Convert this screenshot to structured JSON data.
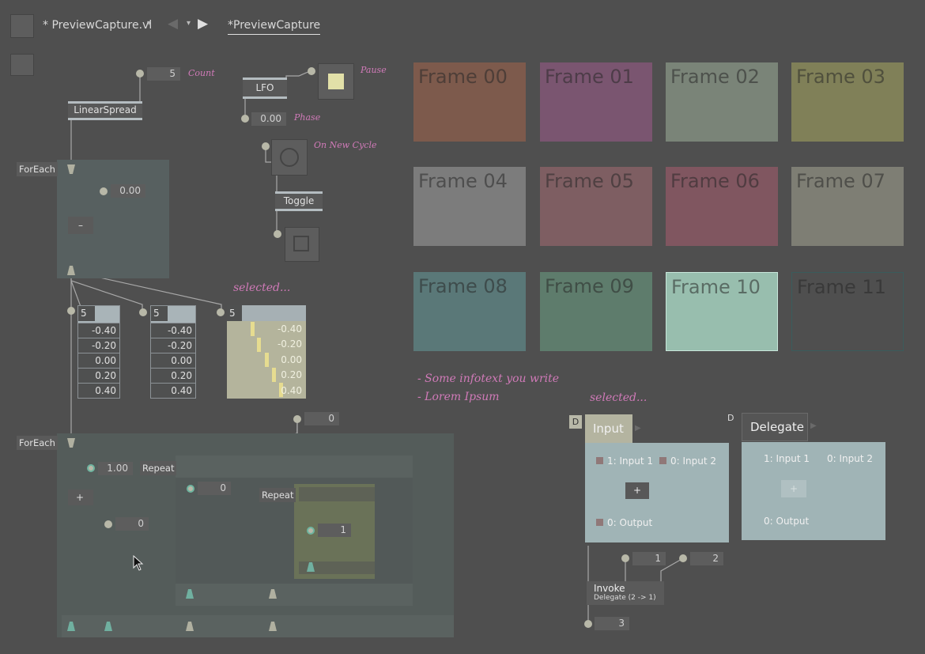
{
  "header": {
    "doc_title": "* PreviewCapture.vl",
    "tab_label": "*PreviewCapture"
  },
  "patch": {
    "count_label": "Count",
    "count_value": "5",
    "linearspread": "LinearSpread",
    "lfo": "LFO",
    "pause_label": "Pause",
    "phase_value": "0.00",
    "phase_label": "Phase",
    "newcycle_label": "On New Cycle",
    "toggle": "Toggle",
    "foreach1": "ForEach",
    "foreach1_input": "0.00",
    "minus": "–",
    "selected1": "selected...",
    "tables": [
      {
        "count": "5",
        "values": [
          "-0.40",
          "-0.20",
          "0.00",
          "0.20",
          "0.40"
        ]
      },
      {
        "count": "5",
        "values": [
          "-0.40",
          "-0.20",
          "0.00",
          "0.20",
          "0.40"
        ]
      },
      {
        "count": "5",
        "values": [
          "-0.40",
          "-0.20",
          "0.00",
          "0.20",
          "0.40"
        ]
      }
    ],
    "zero_top": "0",
    "foreach2": "ForEach",
    "one_input": "1.00",
    "plus": "+",
    "repeat1": "Repeat",
    "repeat2": "Repeat",
    "inner_zero": "0",
    "inner_one": "1",
    "left_zero": "0"
  },
  "frames": [
    "Frame 00",
    "Frame 01",
    "Frame 02",
    "Frame 03",
    "Frame 04",
    "Frame 05",
    "Frame 06",
    "Frame 07",
    "Frame 08",
    "Frame 09",
    "Frame 10",
    "Frame 11"
  ],
  "frame_colors": [
    "#7d5a4c",
    "#7a5570",
    "#7a8478",
    "#808058",
    "#7c7c7c",
    "#7e5e62",
    "#805660",
    "#7e7e74",
    "#5a7878",
    "#5e7c6c",
    "#98beae",
    "#4f4f4f"
  ],
  "infotext": [
    "- Some infotext you write",
    "- Lorem Ipsum"
  ],
  "delegate_area": {
    "selected2": "selected...",
    "d1": "D",
    "d2": "D",
    "input_title": "Input",
    "delegate_title": "Delegate",
    "in1": "1: Input 1",
    "in2": "0: Input 2",
    "out": "0: Output",
    "in1b": "1: Input 1",
    "in2b": "0: Input 2",
    "outb": "0: Output",
    "plus": "+",
    "plus_b": "+",
    "one_val": "1",
    "two_val": "2",
    "invoke": "Invoke",
    "invoke_sub": "Delegate (2 -> 1)",
    "result": "3"
  }
}
